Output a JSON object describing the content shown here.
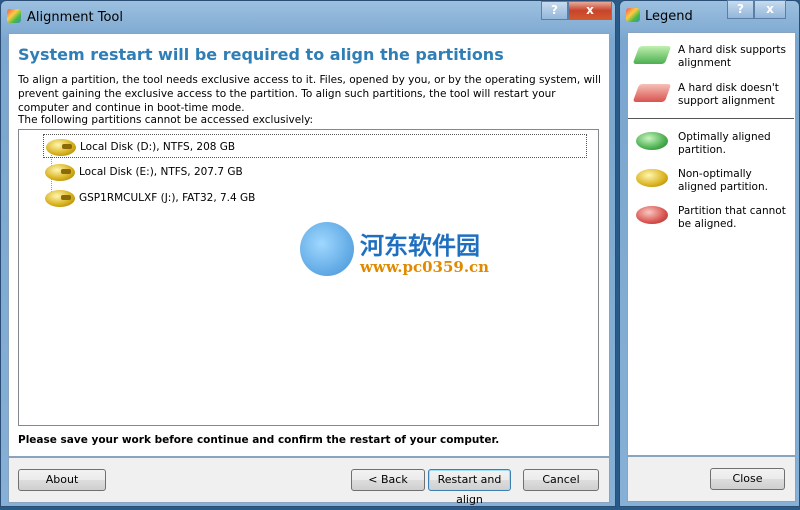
{
  "main_window": {
    "title": "Alignment Tool",
    "help": "?",
    "close": "x",
    "heading": "System restart will be required to align the partitions",
    "description": "To align a partition, the tool needs exclusive access to it. Files, opened by you, or by the operating system, will prevent gaining the exclusive access to the partition. To align such partitions, the tool will restart your computer and continue in boot-time mode.",
    "list_label": "The following partitions cannot be accessed exclusively:",
    "partitions": [
      {
        "label": "Local Disk (D:), NTFS, 208 GB",
        "status": "non-optimally-aligned"
      },
      {
        "label": "Local Disk (E:), NTFS, 207.7 GB",
        "status": "non-optimally-aligned"
      },
      {
        "label": "GSP1RMCULXF (J:), FAT32, 7.4 GB",
        "status": "non-optimally-aligned"
      }
    ],
    "warning": "Please save your work before continue and confirm the restart of your computer.",
    "buttons": {
      "about": "About",
      "back": "< Back",
      "restart": "Restart and align",
      "cancel": "Cancel"
    }
  },
  "legend_window": {
    "title": "Legend",
    "help": "?",
    "close": "x",
    "items": [
      {
        "icon": "hard-disk-green",
        "text": "A hard disk supports alignment"
      },
      {
        "icon": "hard-disk-red",
        "text": "A hard disk doesn't support alignment"
      },
      {
        "icon": "partition-green",
        "text": "Optimally aligned partition."
      },
      {
        "icon": "partition-yellow",
        "text": "Non-optimally aligned partition."
      },
      {
        "icon": "partition-red",
        "text": "Partition that cannot be aligned."
      }
    ],
    "close_button": "Close"
  },
  "watermark": {
    "name": "河东软件园",
    "url": "www.pc0359.cn"
  },
  "colors": {
    "heading": "#2f7fb6",
    "green": "#4caf50",
    "yellow": "#d9b21e",
    "red": "#d9534f"
  }
}
